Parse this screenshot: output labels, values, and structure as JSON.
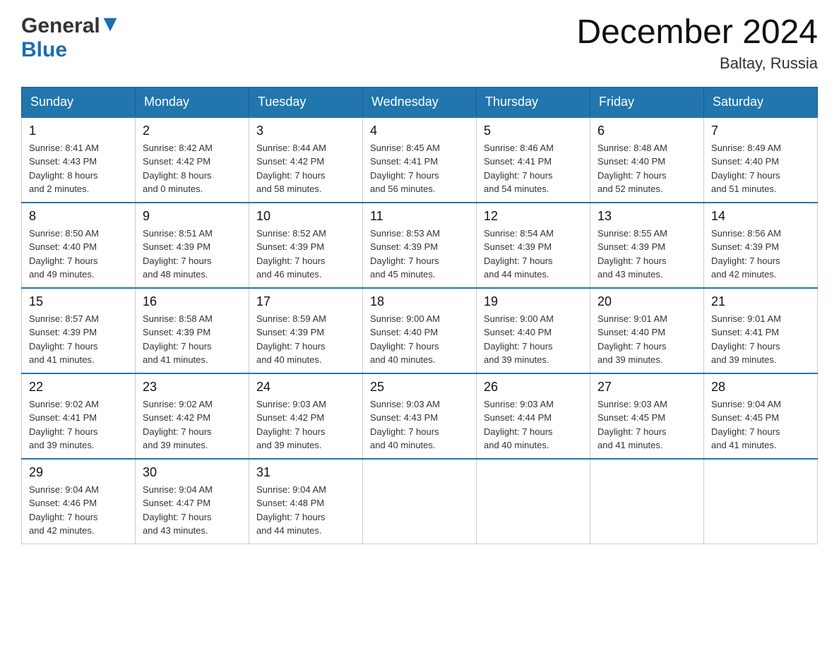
{
  "header": {
    "logo_general": "General",
    "logo_blue": "Blue",
    "month_year": "December 2024",
    "location": "Baltay, Russia"
  },
  "days_of_week": [
    "Sunday",
    "Monday",
    "Tuesday",
    "Wednesday",
    "Thursday",
    "Friday",
    "Saturday"
  ],
  "weeks": [
    [
      {
        "day": "1",
        "sunrise": "8:41 AM",
        "sunset": "4:43 PM",
        "daylight": "8 hours and 2 minutes."
      },
      {
        "day": "2",
        "sunrise": "8:42 AM",
        "sunset": "4:42 PM",
        "daylight": "8 hours and 0 minutes."
      },
      {
        "day": "3",
        "sunrise": "8:44 AM",
        "sunset": "4:42 PM",
        "daylight": "7 hours and 58 minutes."
      },
      {
        "day": "4",
        "sunrise": "8:45 AM",
        "sunset": "4:41 PM",
        "daylight": "7 hours and 56 minutes."
      },
      {
        "day": "5",
        "sunrise": "8:46 AM",
        "sunset": "4:41 PM",
        "daylight": "7 hours and 54 minutes."
      },
      {
        "day": "6",
        "sunrise": "8:48 AM",
        "sunset": "4:40 PM",
        "daylight": "7 hours and 52 minutes."
      },
      {
        "day": "7",
        "sunrise": "8:49 AM",
        "sunset": "4:40 PM",
        "daylight": "7 hours and 51 minutes."
      }
    ],
    [
      {
        "day": "8",
        "sunrise": "8:50 AM",
        "sunset": "4:40 PM",
        "daylight": "7 hours and 49 minutes."
      },
      {
        "day": "9",
        "sunrise": "8:51 AM",
        "sunset": "4:39 PM",
        "daylight": "7 hours and 48 minutes."
      },
      {
        "day": "10",
        "sunrise": "8:52 AM",
        "sunset": "4:39 PM",
        "daylight": "7 hours and 46 minutes."
      },
      {
        "day": "11",
        "sunrise": "8:53 AM",
        "sunset": "4:39 PM",
        "daylight": "7 hours and 45 minutes."
      },
      {
        "day": "12",
        "sunrise": "8:54 AM",
        "sunset": "4:39 PM",
        "daylight": "7 hours and 44 minutes."
      },
      {
        "day": "13",
        "sunrise": "8:55 AM",
        "sunset": "4:39 PM",
        "daylight": "7 hours and 43 minutes."
      },
      {
        "day": "14",
        "sunrise": "8:56 AM",
        "sunset": "4:39 PM",
        "daylight": "7 hours and 42 minutes."
      }
    ],
    [
      {
        "day": "15",
        "sunrise": "8:57 AM",
        "sunset": "4:39 PM",
        "daylight": "7 hours and 41 minutes."
      },
      {
        "day": "16",
        "sunrise": "8:58 AM",
        "sunset": "4:39 PM",
        "daylight": "7 hours and 41 minutes."
      },
      {
        "day": "17",
        "sunrise": "8:59 AM",
        "sunset": "4:39 PM",
        "daylight": "7 hours and 40 minutes."
      },
      {
        "day": "18",
        "sunrise": "9:00 AM",
        "sunset": "4:40 PM",
        "daylight": "7 hours and 40 minutes."
      },
      {
        "day": "19",
        "sunrise": "9:00 AM",
        "sunset": "4:40 PM",
        "daylight": "7 hours and 39 minutes."
      },
      {
        "day": "20",
        "sunrise": "9:01 AM",
        "sunset": "4:40 PM",
        "daylight": "7 hours and 39 minutes."
      },
      {
        "day": "21",
        "sunrise": "9:01 AM",
        "sunset": "4:41 PM",
        "daylight": "7 hours and 39 minutes."
      }
    ],
    [
      {
        "day": "22",
        "sunrise": "9:02 AM",
        "sunset": "4:41 PM",
        "daylight": "7 hours and 39 minutes."
      },
      {
        "day": "23",
        "sunrise": "9:02 AM",
        "sunset": "4:42 PM",
        "daylight": "7 hours and 39 minutes."
      },
      {
        "day": "24",
        "sunrise": "9:03 AM",
        "sunset": "4:42 PM",
        "daylight": "7 hours and 39 minutes."
      },
      {
        "day": "25",
        "sunrise": "9:03 AM",
        "sunset": "4:43 PM",
        "daylight": "7 hours and 40 minutes."
      },
      {
        "day": "26",
        "sunrise": "9:03 AM",
        "sunset": "4:44 PM",
        "daylight": "7 hours and 40 minutes."
      },
      {
        "day": "27",
        "sunrise": "9:03 AM",
        "sunset": "4:45 PM",
        "daylight": "7 hours and 41 minutes."
      },
      {
        "day": "28",
        "sunrise": "9:04 AM",
        "sunset": "4:45 PM",
        "daylight": "7 hours and 41 minutes."
      }
    ],
    [
      {
        "day": "29",
        "sunrise": "9:04 AM",
        "sunset": "4:46 PM",
        "daylight": "7 hours and 42 minutes."
      },
      {
        "day": "30",
        "sunrise": "9:04 AM",
        "sunset": "4:47 PM",
        "daylight": "7 hours and 43 minutes."
      },
      {
        "day": "31",
        "sunrise": "9:04 AM",
        "sunset": "4:48 PM",
        "daylight": "7 hours and 44 minutes."
      },
      null,
      null,
      null,
      null
    ]
  ],
  "labels": {
    "sunrise": "Sunrise:",
    "sunset": "Sunset:",
    "daylight": "Daylight:"
  }
}
